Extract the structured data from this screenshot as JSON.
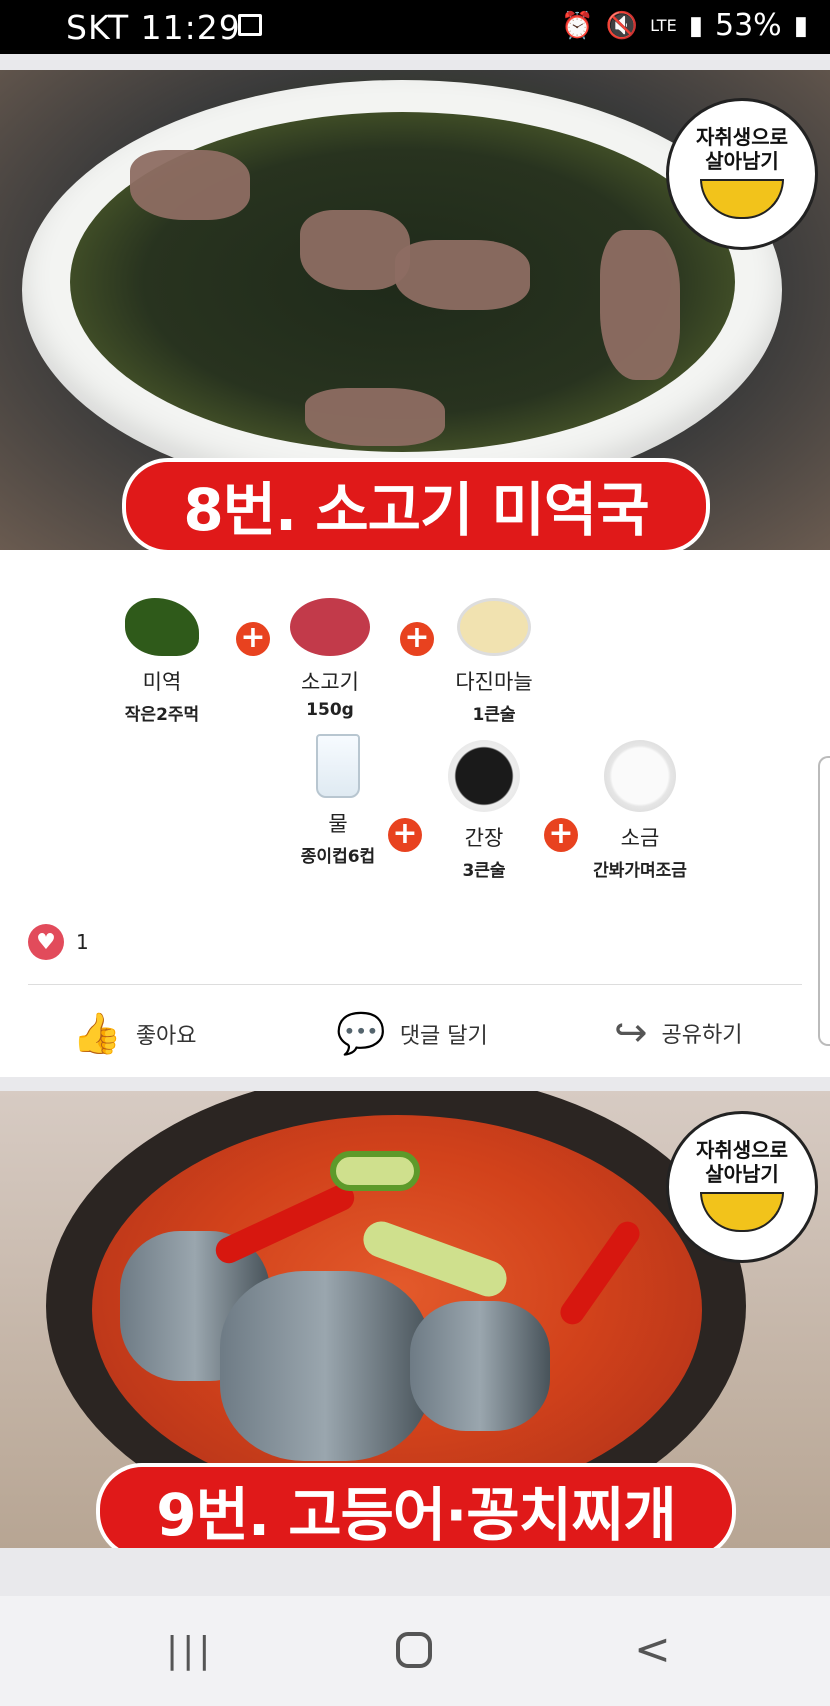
{
  "status_bar": {
    "carrier_time": "SKT 11:29",
    "network": "LTE",
    "battery": "53%"
  },
  "post1": {
    "badge_line1": "자취생으로",
    "badge_line2": "살아남기",
    "title": "8번. 소고기 미역국",
    "ingredients": [
      {
        "name": "미역",
        "qty": "작은2주먹"
      },
      {
        "name": "소고기",
        "qty": "150g"
      },
      {
        "name": "다진마늘",
        "qty": "1큰술"
      },
      {
        "name": "물",
        "qty": "종이컵6컵"
      },
      {
        "name": "간장",
        "qty": "3큰술"
      },
      {
        "name": "소금",
        "qty": "간봐가며조금"
      }
    ],
    "plus_symbol": "+",
    "like_count": "1",
    "actions": {
      "like": "좋아요",
      "comment": "댓글 달기",
      "share": "공유하기"
    }
  },
  "post2": {
    "badge_line1": "자취생으로",
    "badge_line2": "살아남기",
    "title": "9번. 고등어·꽁치찌개"
  },
  "icons": {
    "like": "thumbs-up-icon",
    "comment": "speech-bubble-icon",
    "share": "share-arrow-icon",
    "heart": "heart-icon"
  }
}
